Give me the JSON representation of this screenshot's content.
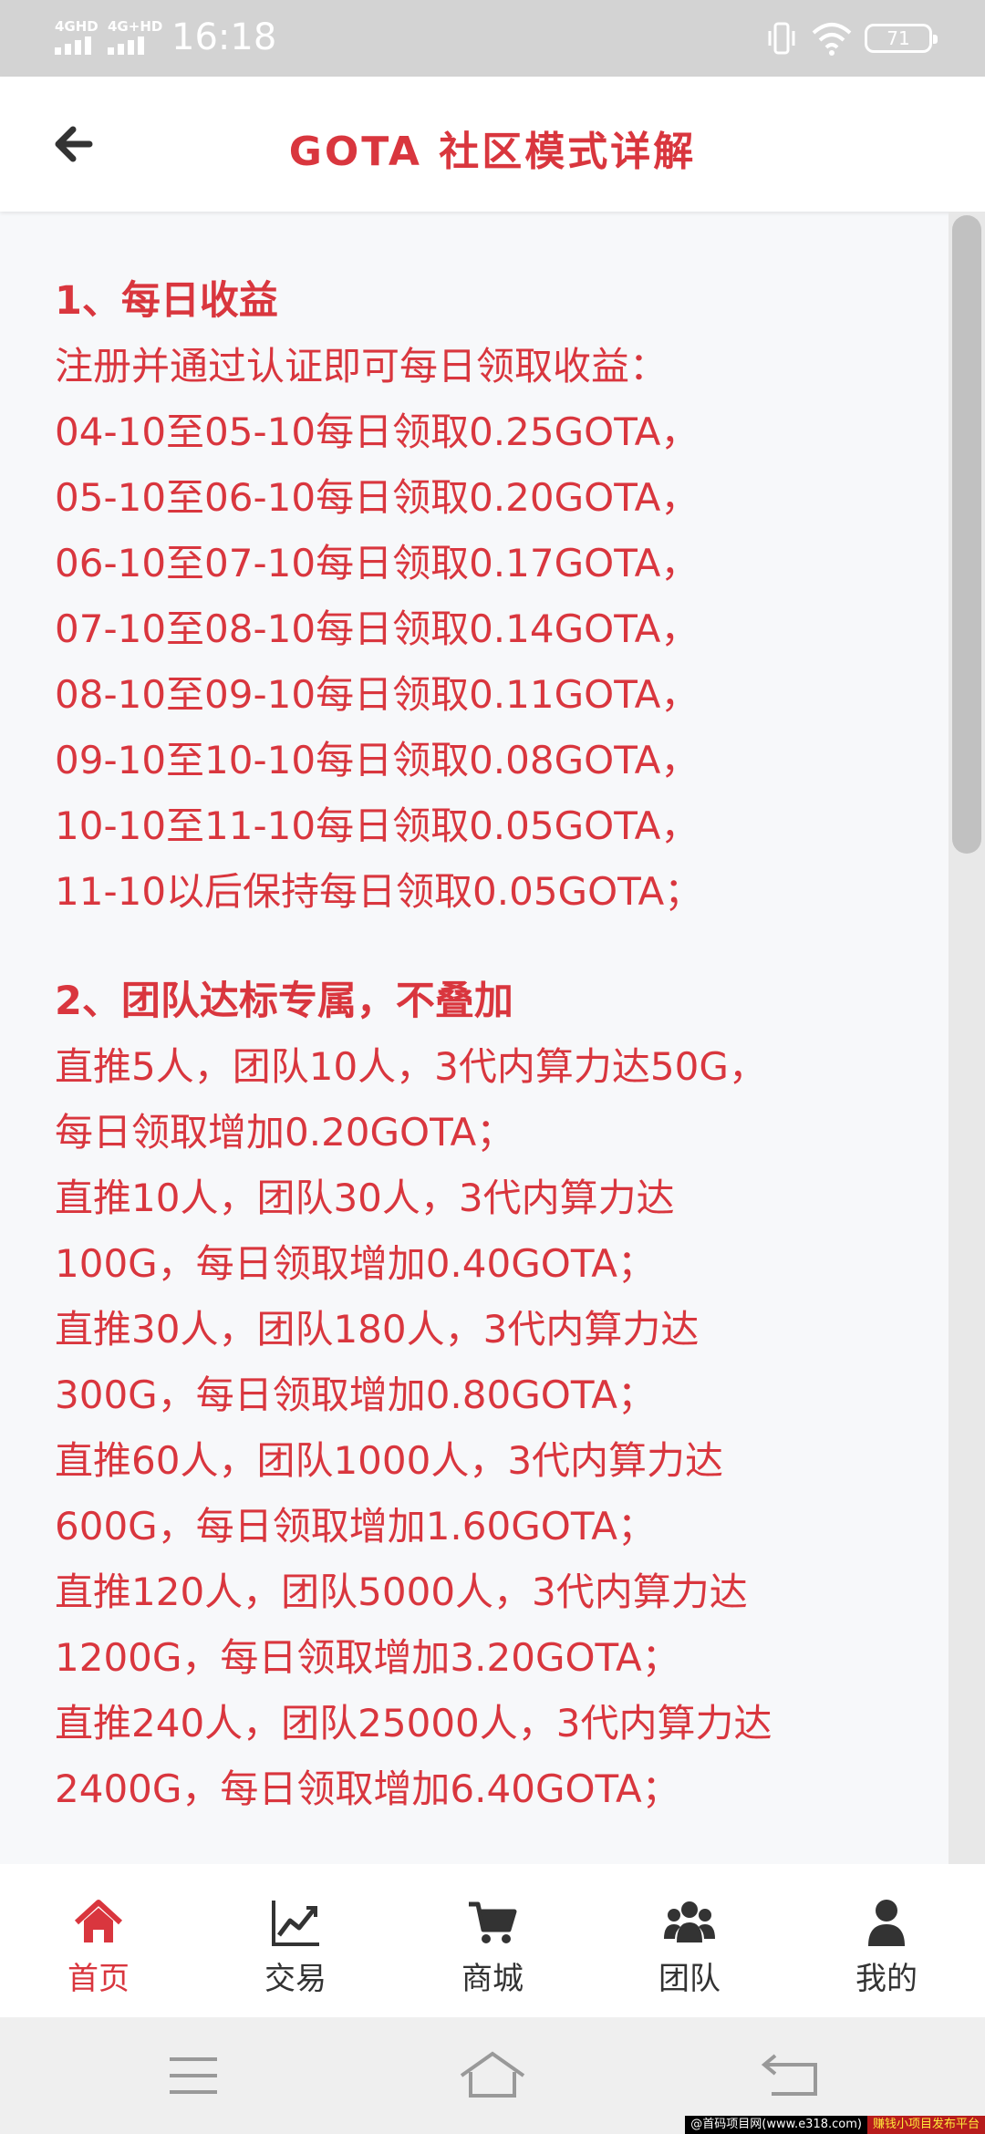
{
  "status_bar": {
    "sim1_label": "4GHD",
    "sim2_label": "4G+HD",
    "time": "16:18",
    "battery_level": "71"
  },
  "header": {
    "back_icon": "arrow-left-icon",
    "title": "GOTA 社区模式详解"
  },
  "sections": [
    {
      "heading": "1、每日收益",
      "lines": [
        "注册并通过认证即可每日领取收益：",
        "04-10至05-10每日领取0.25GOTA，",
        "05-10至06-10每日领取0.20GOTA，",
        "06-10至07-10每日领取0.17GOTA，",
        "07-10至08-10每日领取0.14GOTA，",
        "08-10至09-10每日领取0.11GOTA，",
        "09-10至10-10每日领取0.08GOTA，",
        "10-10至11-10每日领取0.05GOTA，",
        "11-10以后保持每日领取0.05GOTA；"
      ]
    },
    {
      "heading": "2、团队达标专属，不叠加",
      "lines": [
        "直推5人，团队10人，3代内算力达50G，",
        "每日领取增加0.20GOTA；",
        "直推10人，团队30人，3代内算力达",
        "100G，每日领取增加0.40GOTA；",
        "直推30人，团队180人，3代内算力达",
        "300G，每日领取增加0.80GOTA；",
        "直推60人，团队1000人，3代内算力达",
        "600G，每日领取增加1.60GOTA；",
        "直推120人，团队5000人，3代内算力达",
        "1200G，每日领取增加3.20GOTA；",
        "直推240人，团队25000人，3代内算力达",
        "2400G，每日领取增加6.40GOTA；"
      ]
    }
  ],
  "tabs": [
    {
      "label": "首页",
      "icon": "home-icon",
      "active": true
    },
    {
      "label": "交易",
      "icon": "chart-line-icon",
      "active": false
    },
    {
      "label": "商城",
      "icon": "cart-icon",
      "active": false
    },
    {
      "label": "团队",
      "icon": "users-icon",
      "active": false
    },
    {
      "label": "我的",
      "icon": "user-icon",
      "active": false
    }
  ],
  "nav_bar": {
    "buttons": [
      "menu-icon",
      "home-outline-icon",
      "back-icon"
    ]
  },
  "watermark": {
    "left": "@首码项目网(www.e318.com)",
    "right": "赚钱小项目发布平台"
  },
  "colors": {
    "accent": "#d9363e",
    "status_bar": "#d3d3d3",
    "tab_text": "#333333"
  }
}
